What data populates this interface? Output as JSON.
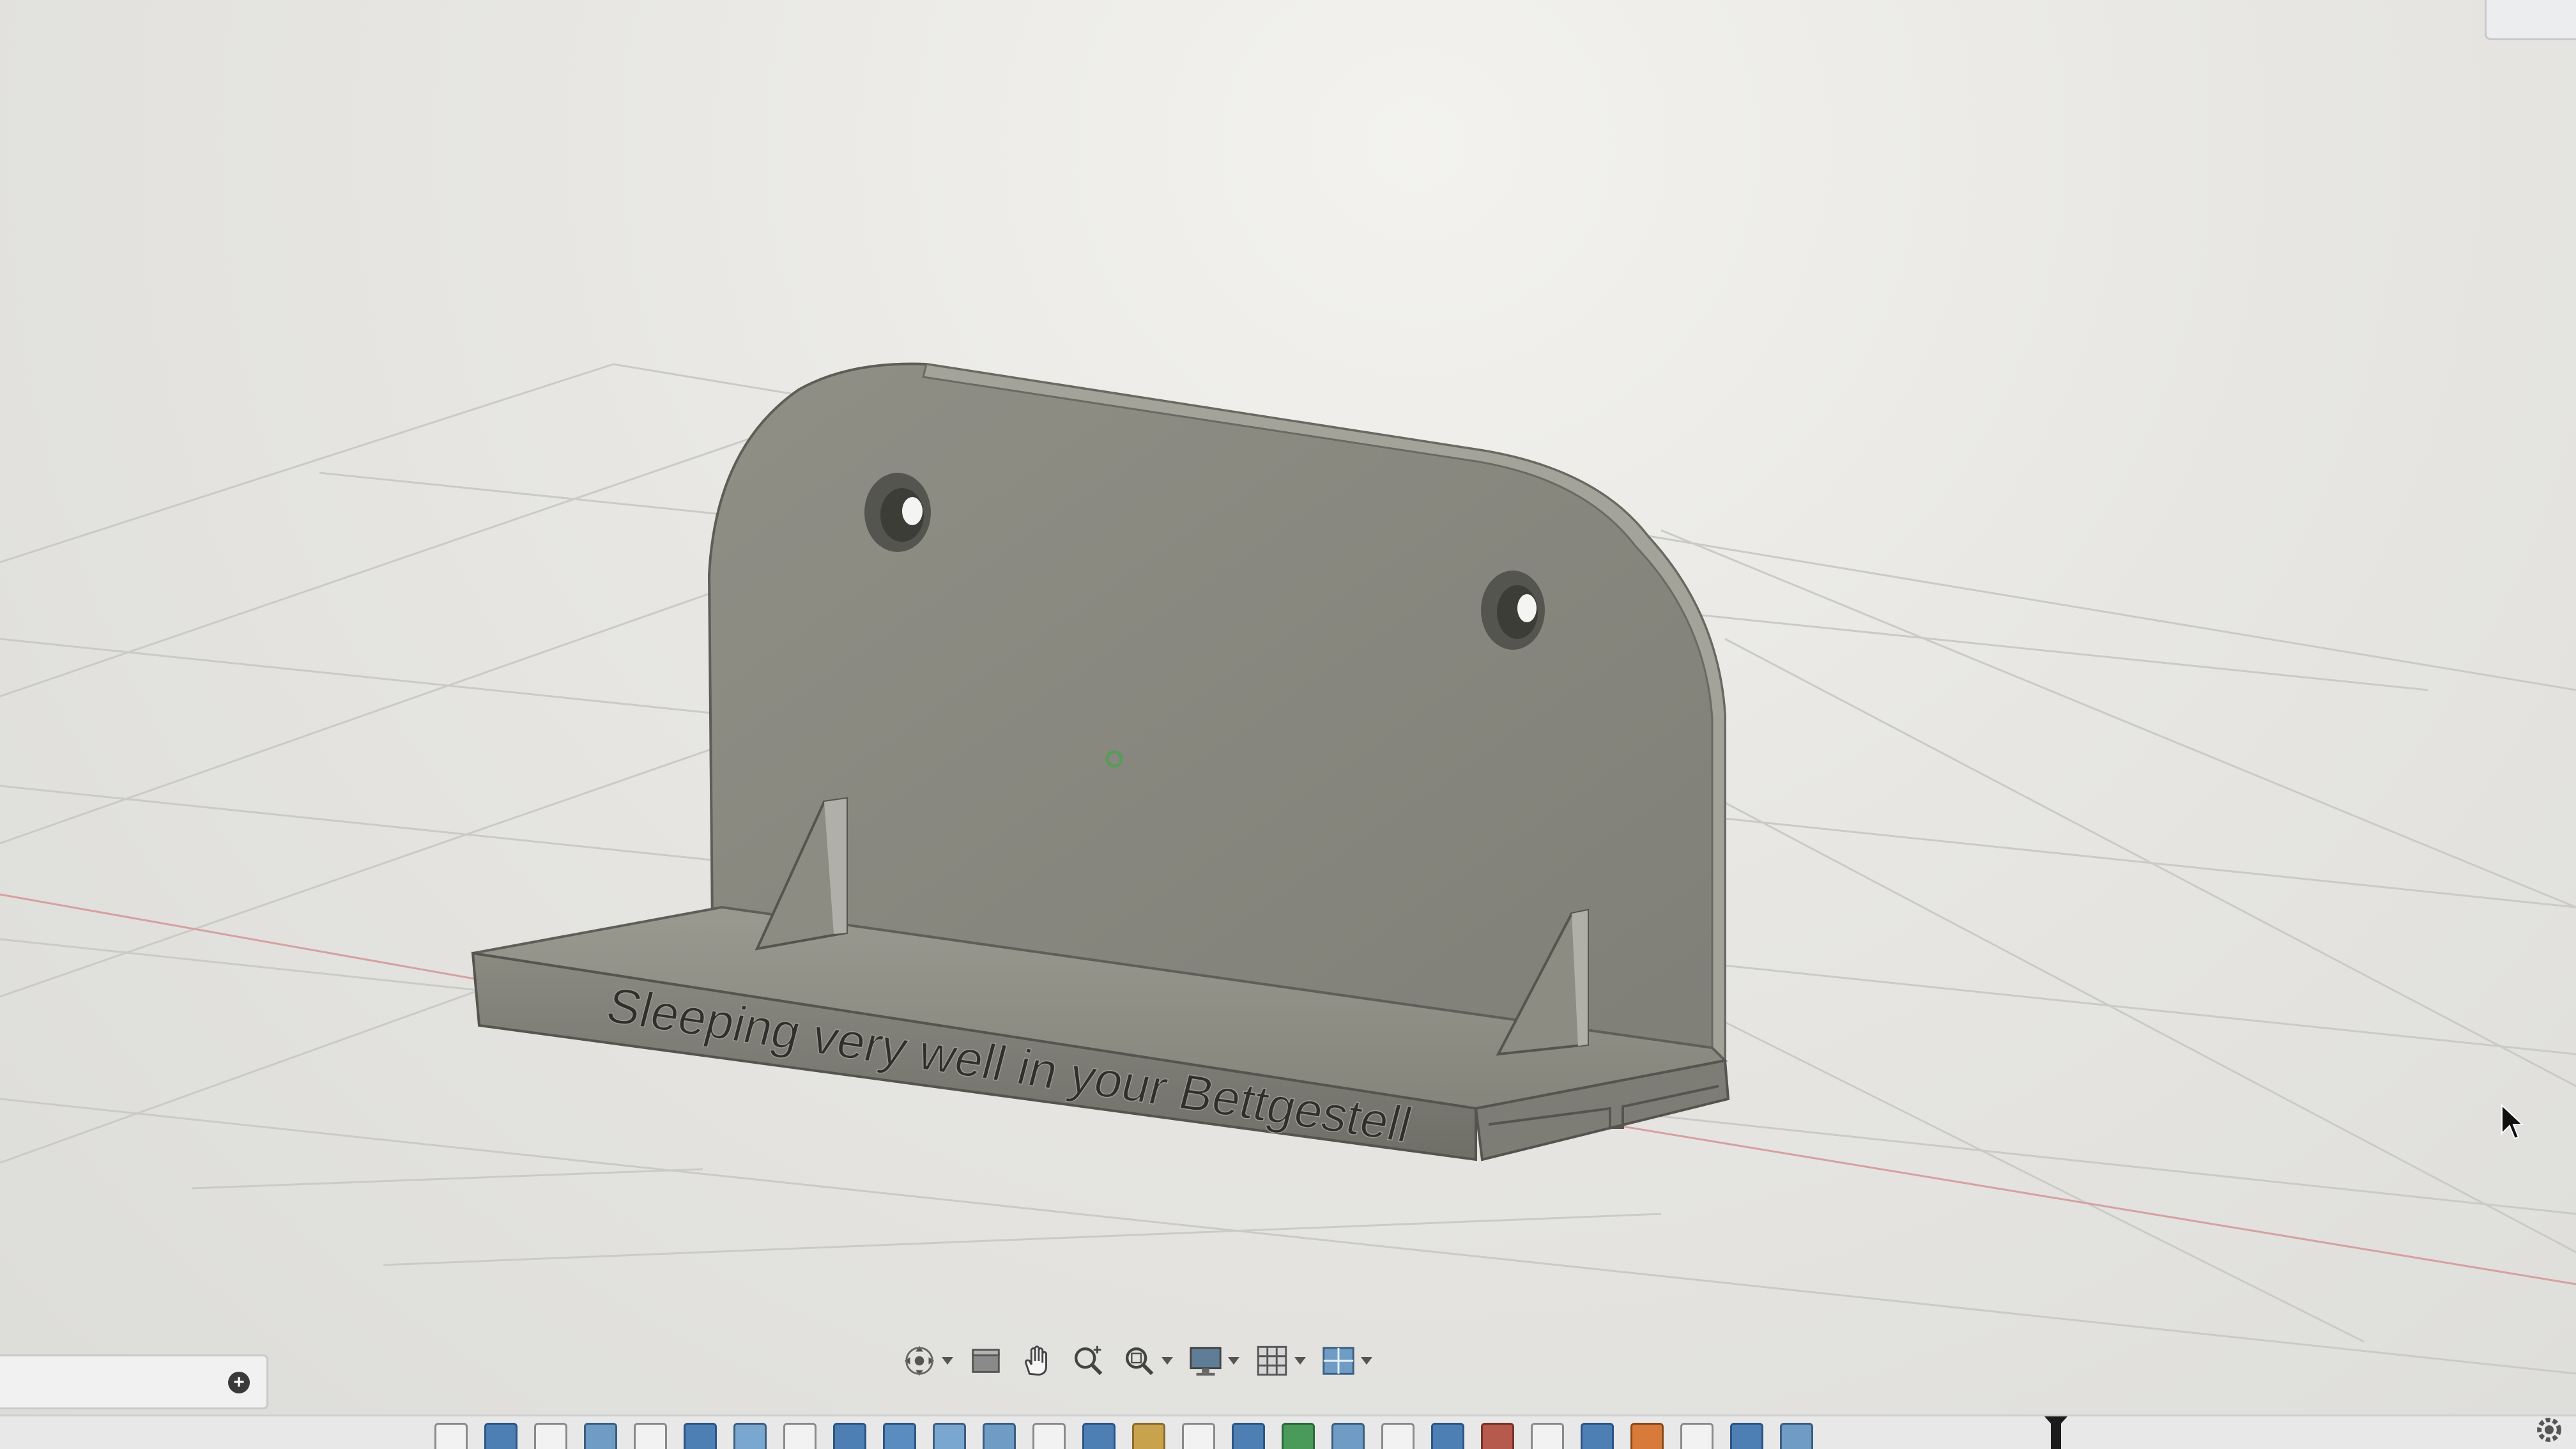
{
  "viewport": {
    "model_text": "Sleeping very well in your Bettgestell",
    "model_color": "#8d8d84",
    "grid_color": "#cfd0cc",
    "axis_red": "#d08b8b"
  },
  "comments_panel": {
    "add_icon": "plus-circle-icon",
    "add_symbol": "+"
  },
  "nav_toolbar": {
    "buttons": [
      {
        "icon": "orbit-icon",
        "has_menu": true
      },
      {
        "icon": "look-at-icon",
        "has_menu": false
      },
      {
        "icon": "pan-hand-icon",
        "has_menu": false
      },
      {
        "icon": "zoom-icon",
        "has_menu": false
      },
      {
        "icon": "zoom-window-icon",
        "has_menu": true
      },
      {
        "icon": "display-settings-icon",
        "has_menu": true
      },
      {
        "icon": "grid-snap-icon",
        "has_menu": true
      },
      {
        "icon": "viewports-icon",
        "has_menu": true
      }
    ]
  },
  "timeline": {
    "feature_icons": [
      "sketch-icon",
      "extrude-icon",
      "sketch-icon",
      "fillet-icon",
      "sketch-icon",
      "extrude-icon",
      "hole-icon",
      "sketch-icon",
      "extrude-icon",
      "chamfer-icon",
      "hole-icon",
      "fillet-icon",
      "sketch-icon",
      "extrude-icon",
      "mirror-icon",
      "sketch-icon",
      "extrude-icon",
      "text-icon",
      "fillet-icon",
      "sketch-icon",
      "extrude-icon",
      "combine-icon",
      "sketch-icon",
      "extrude-icon",
      "split-icon",
      "sketch-icon",
      "extrude-icon",
      "fillet-icon"
    ],
    "marker_icon": "timeline-marker-icon"
  },
  "settings": {
    "icon": "gear-icon"
  },
  "cursor": {
    "icon": "mouse-pointer-icon"
  }
}
